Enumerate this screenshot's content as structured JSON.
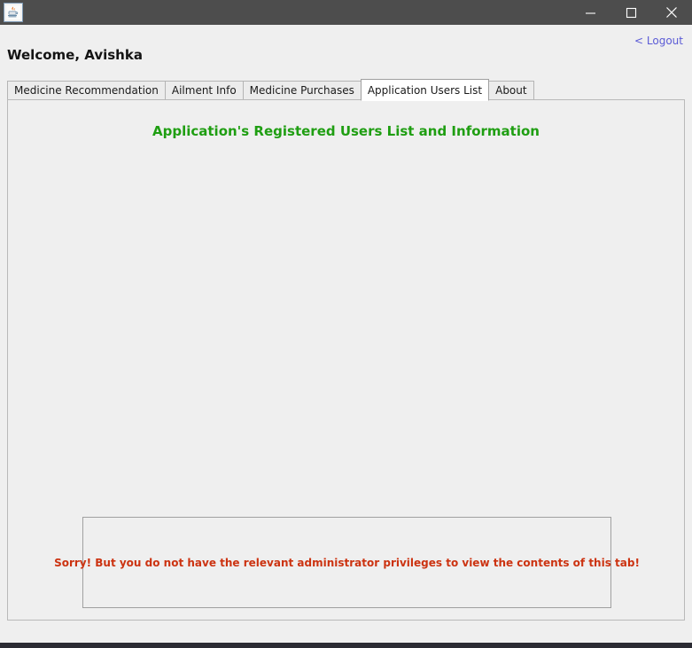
{
  "window": {
    "icon": "java-coffee-cup-icon",
    "controls": {
      "minimize": "minimize-icon",
      "maximize": "maximize-icon",
      "close": "close-icon"
    }
  },
  "header": {
    "welcome_text": "Welcome, Avishka",
    "logout_label": "< Logout"
  },
  "tabs": [
    {
      "label": "Medicine Recommendation",
      "selected": false
    },
    {
      "label": "Ailment Info",
      "selected": false
    },
    {
      "label": "Medicine Purchases",
      "selected": false
    },
    {
      "label": "Application Users List",
      "selected": true
    },
    {
      "label": "About",
      "selected": false
    }
  ],
  "panel": {
    "title": "Application's Registered Users List and Information",
    "notice": "Sorry! But you do not have the relevant administrator privileges to view the contents of this tab!"
  },
  "colors": {
    "titlebar": "#4d4d4d",
    "panel_background": "#efefef",
    "title_green": "#1f9e12",
    "notice_red": "#cc3311",
    "logout_blue": "#5b5bd6",
    "bottom_strip": "#2b2b33"
  }
}
